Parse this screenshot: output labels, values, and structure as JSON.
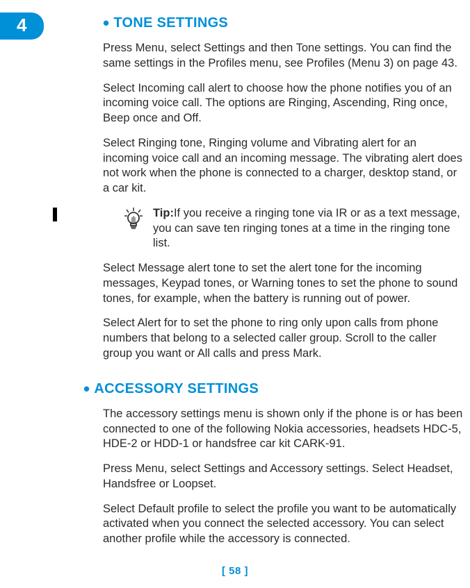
{
  "tab": "4",
  "section1": {
    "heading": "TONE SETTINGS",
    "p1": "Press Menu, select Settings and then Tone settings. You can find the same settings in the Profiles menu, see Profiles (Menu 3) on page 43.",
    "p2": "Select Incoming call alert to choose how the phone notifies you of an incoming voice call. The options are Ringing, Ascending, Ring once, Beep once and Off.",
    "p3": "Select Ringing tone, Ringing volume and Vibrating alert for an incoming voice call and an incoming message. The vibrating alert does not work when the phone is connected to a charger, desktop stand, or a car kit.",
    "tip_label": "Tip:",
    "tip_text": "If you receive a ringing tone via IR or as a text message, you can save ten ringing tones at a time in the ringing tone list.",
    "p4": "Select Message alert tone to set the alert tone for the incoming messages, Keypad tones, or Warning tones to set the phone to sound tones, for example, when the battery is running out of power.",
    "p5": "Select Alert for to set the phone to ring only upon calls from phone numbers that belong to a selected caller group. Scroll to the caller group you want or All calls and press Mark."
  },
  "section2": {
    "heading": "ACCESSORY SETTINGS",
    "p1": "The accessory settings menu is shown only if the phone is or has been connected to one of the following Nokia accessories, headsets HDC-5, HDE-2 or HDD-1 or handsfree car kit CARK-91.",
    "p2": "Press Menu, select Settings and Accessory settings. Select Headset, Handsfree or Loopset.",
    "p3": "Select Default profile to select the profile you want to be automatically activated when you connect the selected accessory. You can select another profile while the accessory is connected."
  },
  "page_number": "[ 58 ]"
}
